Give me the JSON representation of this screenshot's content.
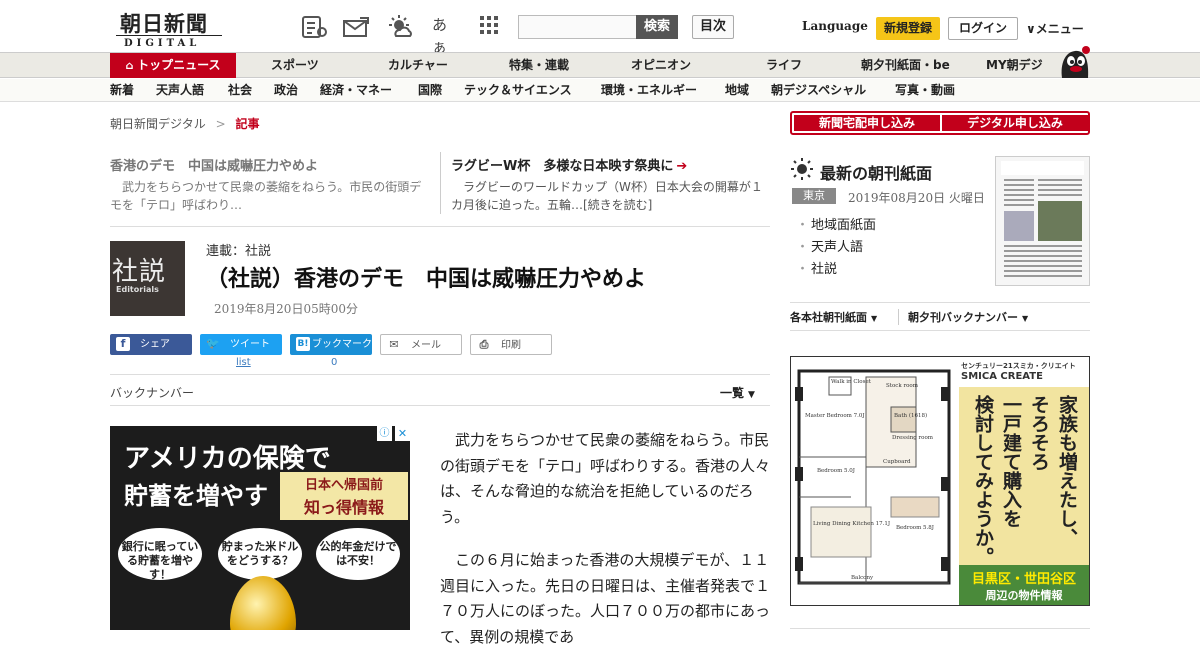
{
  "header": {
    "logo_main": "朝日新聞",
    "logo_sub": "DIGITAL",
    "icons": [
      "newspaper-icon",
      "mail-icon",
      "weather-icon",
      "font-size-icon",
      "grid-icon"
    ],
    "font_size_label": "あぁ",
    "search_placeholder": "",
    "search_button": "検索",
    "toc_button": "目次",
    "language": "Language",
    "register": "新規登録",
    "login": "ログイン",
    "menu": "∨メニュー"
  },
  "nav_primary": [
    "トップニュース",
    "スポーツ",
    "カルチャー",
    "特集・連載",
    "オピニオン",
    "ライフ",
    "朝夕刊紙面・be",
    "MY朝デジ"
  ],
  "nav_secondary": [
    "新着",
    "天声人語",
    "社会",
    "政治",
    "経済・マネー",
    "国際",
    "テック＆サイエンス",
    "環境・エネルギー",
    "地域",
    "朝デジスペシャル",
    "写真・動画"
  ],
  "breadcrumb": {
    "home": "朝日新聞デジタル",
    "sep": ">",
    "current": "記事"
  },
  "related": [
    {
      "title": "香港のデモ　中国は威嚇圧力やめよ",
      "desc": "武力をちらつかせて民衆の萎縮をねらう。市民の街頭デモを「テロ」呼ばわり…"
    },
    {
      "title": "ラグビーW杯　多様な日本映す祭典に",
      "desc": "ラグビーのワールドカップ（W杯）日本大会の開幕が１カ月後に迫った。五輪…[続きを読む]"
    }
  ],
  "article": {
    "badge_jp": "社説",
    "badge_en": "Editorials",
    "series": "連載：社説",
    "title": "（社説）香港のデモ　中国は威嚇圧力やめよ",
    "date": "2019年8月20日05時00分",
    "paragraphs": [
      "武力をちらつかせて民衆の萎縮をねらう。市民の街頭デモを「テロ」呼ばわりする。香港の人々は、そんな脅迫的な統治を拒絶しているのだろう。",
      "この６月に始まった香港の大規模デモが、１１週目に入った。先日の日曜日は、主催者発表で１７０万人にのぼった。人口７００万の都市にあって、異例の規模であ"
    ]
  },
  "share": {
    "facebook": "シェア",
    "twitter": "ツイート",
    "hatena": "ブックマーク",
    "mail": "メール",
    "print": "印刷",
    "twitter_count": "list",
    "hatena_count": "0"
  },
  "backnumber": {
    "label": "バックナンバー",
    "list": "一覧"
  },
  "ad_left": {
    "headline1": "アメリカの保険で",
    "headline2": "貯蓄を増やす",
    "box1": "日本へ帰国前",
    "box2": "知っ得情報",
    "bubbles": [
      "銀行に眠っている貯蓄を増やす！",
      "貯まった米ドルをどうする？",
      "公的年金だけでは不安！"
    ],
    "adchoice": "ⓘ",
    "close": "✕"
  },
  "sidebar": {
    "subscribe_paper": "新聞宅配申し込み",
    "subscribe_digital": "デジタル申し込み",
    "latest_title": "最新の朝刊紙面",
    "region": "東京",
    "date": "2019年08月20日 火曜日",
    "links": [
      "地域面紙面",
      "天声人語",
      "社説"
    ],
    "dropdown1": "各本社朝刊紙面",
    "dropdown2": "朝夕刊バックナンバー"
  },
  "ad_right": {
    "brand_line1": "センチュリー21スミカ・クリエイト",
    "brand_line2": "SMICA CREATE",
    "copy_col1": "家族も増えたし、",
    "copy_col2": "そろそろ",
    "copy_col3": "一戸建て購入を",
    "copy_col4": "検討してみようか。",
    "footer1": "目黒区・世田谷区",
    "footer2": "周辺の物件情報",
    "rooms": [
      "Walk in Closet",
      "Master Bedroom 7.0J",
      "Bedroom 5.0J",
      "Living Dining Kitchen 17.1J",
      "Bedroom 5.8J",
      "Stock room",
      "Bath (1618)",
      "Dressing room",
      "Cupboard",
      "Balcony"
    ]
  }
}
